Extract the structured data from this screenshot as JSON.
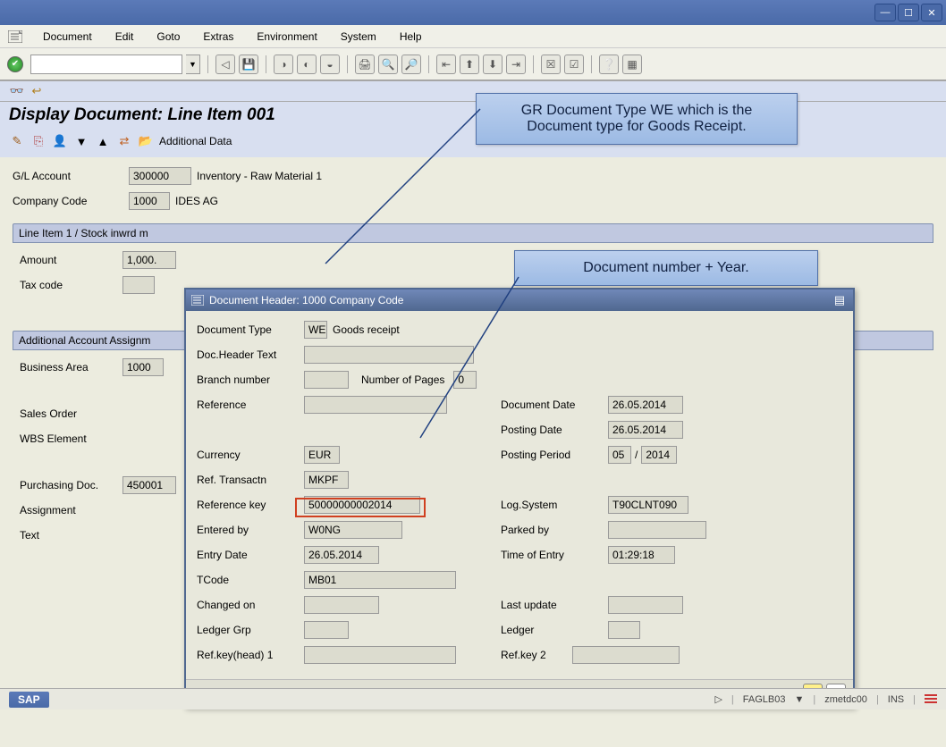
{
  "menu": {
    "document": "Document",
    "edit": "Edit",
    "goto": "Goto",
    "extras": "Extras",
    "environment": "Environment",
    "system": "System",
    "help": "Help"
  },
  "page": {
    "title": "Display Document: Line Item 001",
    "additional_data": "Additional Data"
  },
  "header": {
    "gl_account_lbl": "G/L Account",
    "gl_account": "300000",
    "gl_account_desc": "Inventory - Raw Material 1",
    "company_code_lbl": "Company Code",
    "company_code": "1000",
    "company_name": "IDES AG"
  },
  "group1": {
    "title": "Line Item 1 / Stock inwrd m",
    "amount_lbl": "Amount",
    "amount": "1,000.",
    "tax_code_lbl": "Tax code",
    "tax_code": ""
  },
  "group2": {
    "title": "Additional Account Assignm",
    "business_area_lbl": "Business Area",
    "business_area": "1000",
    "sales_order_lbl": "Sales Order",
    "wbs_element_lbl": "WBS Element",
    "purchasing_doc_lbl": "Purchasing Doc.",
    "purchasing_doc": "450001",
    "assignment_lbl": "Assignment",
    "text_lbl": "Text"
  },
  "dialog": {
    "title": "Document Header: 1000 Company Code",
    "doc_type_lbl": "Document Type",
    "doc_type": "WE",
    "doc_type_desc": "Goods receipt",
    "header_text_lbl": "Doc.Header Text",
    "header_text": "",
    "branch_lbl": "Branch number",
    "branch": "",
    "pages_lbl": "Number of Pages",
    "pages": "0",
    "reference_lbl": "Reference",
    "reference": "",
    "doc_date_lbl": "Document Date",
    "doc_date": "26.05.2014",
    "posting_date_lbl": "Posting Date",
    "posting_date": "26.05.2014",
    "posting_period_lbl": "Posting Period",
    "posting_period_m": "05",
    "posting_period_y": "2014",
    "currency_lbl": "Currency",
    "currency": "EUR",
    "ref_tx_lbl": "Ref. Transactn",
    "ref_tx": "MKPF",
    "ref_key_lbl": "Reference key",
    "ref_key": "50000000002014",
    "log_system_lbl": "Log.System",
    "log_system": "T90CLNT090",
    "entered_by_lbl": "Entered by",
    "entered_by": "W0NG",
    "parked_by_lbl": "Parked by",
    "parked_by": "",
    "entry_date_lbl": "Entry Date",
    "entry_date": "26.05.2014",
    "entry_time_lbl": "Time of Entry",
    "entry_time": "01:29:18",
    "tcode_lbl": "TCode",
    "tcode": "MB01",
    "changed_on_lbl": "Changed on",
    "changed_on": "",
    "last_update_lbl": "Last update",
    "last_update": "",
    "ledger_grp_lbl": "Ledger Grp",
    "ledger_grp": "",
    "ledger_lbl": "Ledger",
    "ledger": "",
    "ref_key1_lbl": "Ref.key(head) 1",
    "ref_key1": "",
    "ref_key2_lbl": "Ref.key 2",
    "ref_key2": ""
  },
  "callout1": "GR Document Type WE which is the Document type for Goods Receipt.",
  "callout2": "Document number + Year.",
  "status": {
    "tcode": "FAGLB03",
    "system": "zmetdc00",
    "ins": "INS"
  }
}
